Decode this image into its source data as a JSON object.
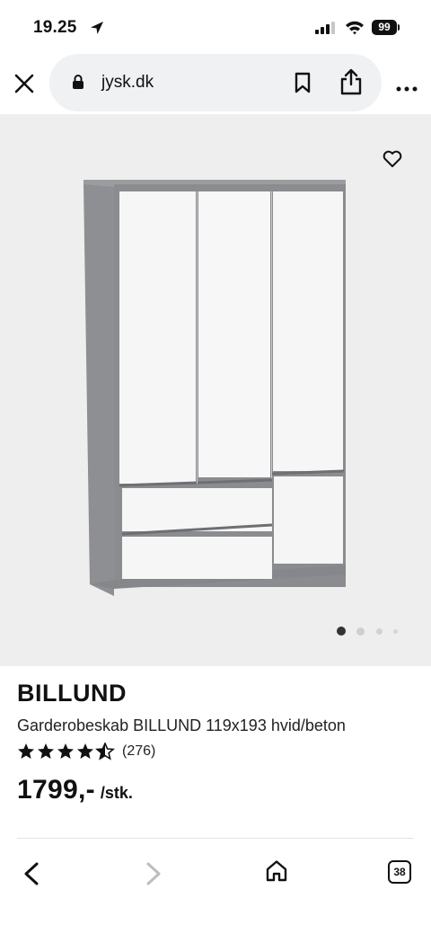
{
  "status_bar": {
    "time": "19.25",
    "battery": "99"
  },
  "browser": {
    "url": "jysk.dk",
    "tab_count": "38",
    "icons": [
      "close-icon",
      "lock-icon",
      "bookmark-icon",
      "share-icon",
      "more-icon",
      "back-icon",
      "forward-icon",
      "home-icon"
    ]
  },
  "gallery": {
    "dots": 4,
    "active_dot": 1
  },
  "product": {
    "name": "BILLUND",
    "description": "Garderobeskab BILLUND 119x193 hvid/beton",
    "rating": 4.5,
    "review_count": "(276)",
    "price": "1799,-",
    "price_unit": "/stk."
  },
  "colors": {
    "image_bg": "#eeeeee",
    "url_pill": "#f0f1f3",
    "text": "#111111"
  }
}
